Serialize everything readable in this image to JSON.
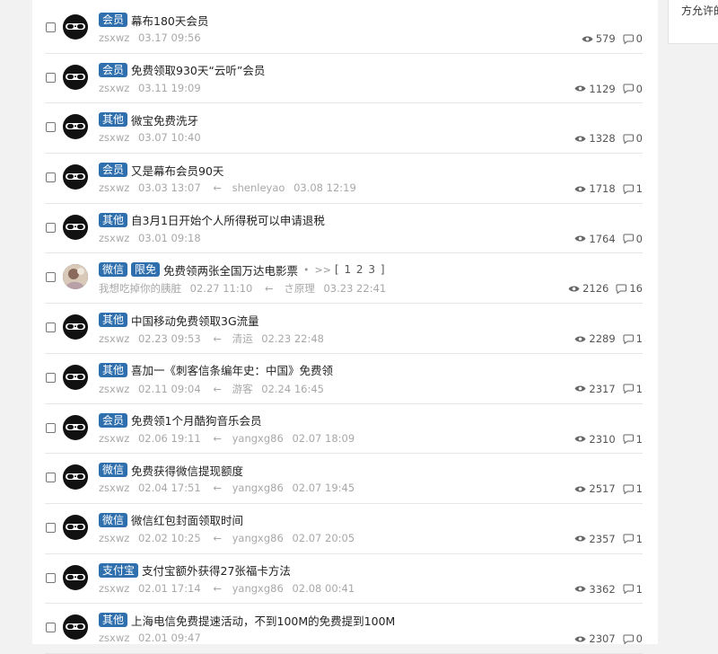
{
  "sidebar": {
    "text": "方允许的"
  },
  "posts": [
    {
      "tag": "会员",
      "title": "幕布180天会员",
      "author": "zsxwz",
      "time": "03.17 09:56",
      "views": "579",
      "replies": "0"
    },
    {
      "tag": "会员",
      "title": "免费领取930天“云听”会员",
      "author": "zsxwz",
      "time": "03.11 19:09",
      "views": "1129",
      "replies": "0"
    },
    {
      "tag": "其他",
      "title": "微宝免费洗牙",
      "author": "zsxwz",
      "time": "03.07 10:40",
      "views": "1328",
      "replies": "0"
    },
    {
      "tag": "会员",
      "title": "又是幕布会员90天",
      "author": "zsxwz",
      "time": "03.03 13:07",
      "last_user": "shenleyao",
      "last_time": "03.08 12:19",
      "views": "1718",
      "replies": "1"
    },
    {
      "tag": "其他",
      "title": "自3月1日开始个人所得税可以申请退税",
      "author": "zsxwz",
      "time": "03.01 09:18",
      "views": "1764",
      "replies": "0"
    },
    {
      "tag": "微信",
      "tag2": "限免",
      "title": "免费领两张全国万达电影票",
      "dot": "•",
      "pages_prefix": ">>",
      "pages": "[ 1 2 3 ]",
      "author": "我想吃掉你的胰脏",
      "time": "02.27 11:10",
      "last_user": "さ原理",
      "last_time": "03.23 22:41",
      "views": "2126",
      "replies": "16",
      "avatar": "photo"
    },
    {
      "tag": "其他",
      "title": "中国移动免费领取3G流量",
      "author": "zsxwz",
      "time": "02.23 09:53",
      "last_user": "清运",
      "last_time": "02.23 22:48",
      "views": "2289",
      "replies": "1"
    },
    {
      "tag": "其他",
      "title": "喜加一《刺客信条编年史：中国》免费领",
      "author": "zsxwz",
      "time": "02.11 09:04",
      "last_user": "游客",
      "last_time": "02.24 16:45",
      "views": "2317",
      "replies": "1"
    },
    {
      "tag": "会员",
      "title": "免费领1个月酷狗音乐会员",
      "author": "zsxwz",
      "time": "02.06 19:11",
      "last_user": "yangxg86",
      "last_time": "02.07 18:09",
      "views": "2310",
      "replies": "1"
    },
    {
      "tag": "微信",
      "title": "免费获得微信提现额度",
      "author": "zsxwz",
      "time": "02.04 17:51",
      "last_user": "yangxg86",
      "last_time": "02.07 19:45",
      "views": "2517",
      "replies": "1"
    },
    {
      "tag": "微信",
      "title": "微信红包封面领取时间",
      "author": "zsxwz",
      "time": "02.02 10:25",
      "last_user": "yangxg86",
      "last_time": "02.07 20:05",
      "views": "2357",
      "replies": "1"
    },
    {
      "tag": "支付宝",
      "title": "支付宝额外获得27张福卡方法",
      "author": "zsxwz",
      "time": "02.01 17:14",
      "last_user": "yangxg86",
      "last_time": "02.08 00:41",
      "views": "3362",
      "replies": "1"
    },
    {
      "tag": "其他",
      "title": "上海电信免费提速活动，不到100M的免费提到100M",
      "author": "zsxwz",
      "time": "02.01 09:47",
      "views": "2307",
      "replies": "0"
    }
  ],
  "labels": {
    "arrow": "←"
  },
  "colors": {
    "tag_bg": "#2f6fad",
    "meta": "#a8a8a8",
    "divider": "#e6e6e6"
  },
  "icons": {
    "views": "eye-icon",
    "replies": "comment-icon",
    "select": "checkbox"
  }
}
